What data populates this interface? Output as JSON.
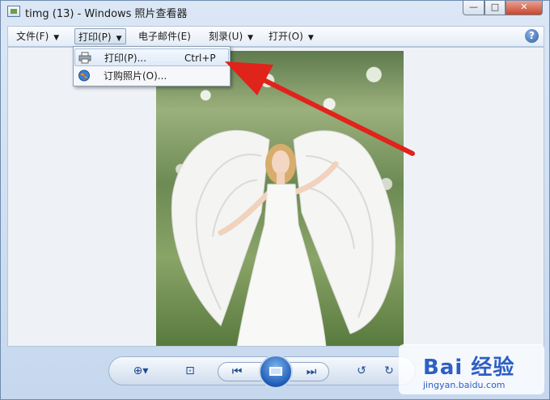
{
  "window": {
    "title": "timg (13) - Windows 照片查看器"
  },
  "controls": {
    "minimize": "—",
    "maximize": "□",
    "close": "✕"
  },
  "menubar": {
    "items": [
      {
        "label": "文件(F)"
      },
      {
        "label": "打印(P)"
      },
      {
        "label": "电子邮件(E)"
      },
      {
        "label": "刻录(U)"
      },
      {
        "label": "打开(O)"
      }
    ],
    "caret": "▼",
    "help": "?"
  },
  "print_menu": {
    "items": [
      {
        "label": "打印(P)...",
        "shortcut": "Ctrl+P",
        "icon": "printer-icon"
      },
      {
        "label": "订购照片(O)...",
        "shortcut": "",
        "icon": "globe-icon"
      }
    ]
  },
  "toolbar": {
    "zoom": "⊕▾",
    "fit": "⊡",
    "prev": "⏮",
    "next": "⏭",
    "rotate_left": "↺",
    "rotate_right": "↻",
    "delete": "✕"
  },
  "watermark": {
    "logo": "Bai 经验",
    "url": "jingyan.baidu.com"
  },
  "colors": {
    "arrow": "#e0231b",
    "accent": "#1e5db6"
  }
}
